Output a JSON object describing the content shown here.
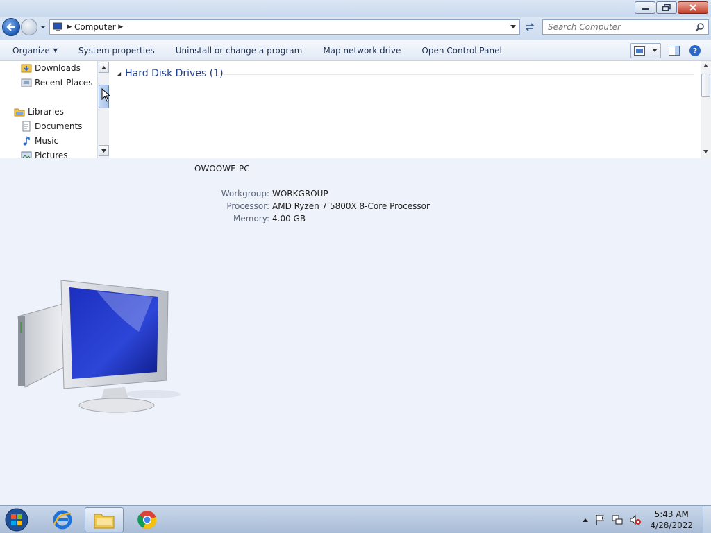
{
  "window": {
    "minimize_icon": "minimize-icon",
    "maximize_icon": "restore-icon",
    "close_icon": "close-icon"
  },
  "address": {
    "breadcrumb": [
      "Computer"
    ],
    "search_placeholder": "Search Computer"
  },
  "toolbar": {
    "organize": "Organize",
    "items": [
      "System properties",
      "Uninstall or change a program",
      "Map network drive",
      "Open Control Panel"
    ]
  },
  "nav": {
    "downloads": "Downloads",
    "recent_places": "Recent Places",
    "libraries": "Libraries",
    "documents": "Documents",
    "music": "Music",
    "pictures": "Pictures"
  },
  "content": {
    "group_title": "Hard Disk Drives (1)"
  },
  "details": {
    "pc_name": "OWOOWE-PC",
    "rows": [
      {
        "label": "Workgroup:",
        "value": "WORKGROUP"
      },
      {
        "label": "Processor:",
        "value": "AMD Ryzen 7 5800X 8-Core Processor"
      },
      {
        "label": "Memory:",
        "value": "4.00 GB"
      }
    ]
  },
  "taskbar": {
    "time": "5:43 AM",
    "date": "4/28/2022"
  },
  "colors": {
    "accent": "#1e5cb3",
    "group_title": "#1e3d8a",
    "details_bg": "#eef2fb"
  }
}
